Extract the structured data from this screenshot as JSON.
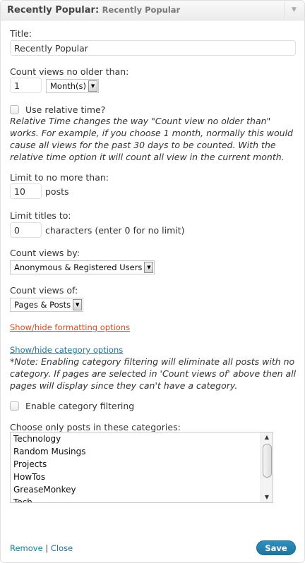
{
  "header": {
    "title": "Recently Popular",
    "separator": ":",
    "subtitle": "Recently Popular",
    "toggle_glyph": "▼"
  },
  "fields": {
    "title_label": "Title:",
    "title_value": "Recently Popular",
    "count_label": "Count views no older than:",
    "count_value": "1",
    "count_unit": "Month(s)",
    "relative_label": "Use relative time?",
    "relative_note": "Relative Time changes the way \"Count view no older than\" works. For example, if you choose 1 month, normally this would cause all views for the past 30 days to be counted. With the relative time option it will count all view in the current month.",
    "limit_label": "Limit to no more than:",
    "limit_value": "10",
    "limit_suffix": "posts",
    "titles_label": "Limit titles to:",
    "titles_value": "0",
    "titles_suffix": "characters (enter 0 for no limit)",
    "count_by_label": "Count views by:",
    "count_by_value": "Anonymous & Registered Users",
    "count_of_label": "Count views of:",
    "count_of_value": "Pages & Posts",
    "formatting_link": "Show/hide formatting options",
    "category_link": "Show/hide category options",
    "category_note": "*Note: Enabling category filtering will eliminate all posts with no category. If pages are selected in 'Count views of' above then all pages will display since they can't have a category.",
    "enable_filter_label": "Enable category filtering",
    "categories_label": "Choose only posts in these categories:",
    "categories": [
      "Technology",
      "Random Musings",
      "Projects",
      "HowTos",
      "GreaseMonkey",
      "Tech"
    ]
  },
  "footer": {
    "remove": "Remove",
    "separator": "|",
    "close": "Close",
    "save": "Save"
  },
  "colors": {
    "link_orange": "#d54e21",
    "link_blue": "#21759b",
    "save_button": "#21759b"
  }
}
